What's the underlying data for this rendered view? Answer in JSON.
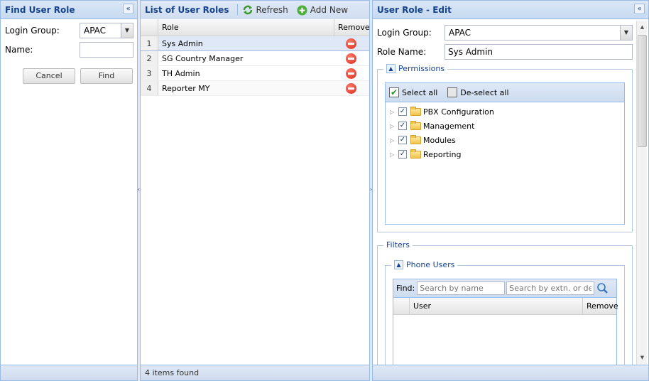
{
  "find_panel": {
    "title": "Find User Role",
    "login_group_label": "Login Group:",
    "login_group_value": "APAC",
    "name_label": "Name:",
    "name_value": "",
    "cancel_label": "Cancel",
    "find_label": "Find"
  },
  "list_panel": {
    "title": "List of User Roles",
    "refresh_label": "Refresh",
    "add_new_label": "Add New",
    "columns": {
      "role": "Role",
      "remove": "Remove"
    },
    "rows": [
      {
        "num": "1",
        "role": "Sys Admin"
      },
      {
        "num": "2",
        "role": "SG Country Manager"
      },
      {
        "num": "3",
        "role": "TH Admin"
      },
      {
        "num": "4",
        "role": "Reporter MY"
      }
    ],
    "status": "4 items found"
  },
  "edit_panel": {
    "title": "User Role - Edit",
    "login_group_label": "Login Group:",
    "login_group_value": "APAC",
    "role_name_label": "Role Name:",
    "role_name_value": "Sys Admin",
    "permissions": {
      "legend": "Permissions",
      "select_all": "Select all",
      "deselect_all": "De-select all",
      "items": [
        {
          "label": "PBX Configuration",
          "checked": true
        },
        {
          "label": "Management",
          "checked": true
        },
        {
          "label": "Modules",
          "checked": true
        },
        {
          "label": "Reporting",
          "checked": true
        }
      ]
    },
    "filters": {
      "legend": "Filters",
      "phone_users": {
        "legend": "Phone Users",
        "find_label": "Find:",
        "search_name_placeholder": "Search by name",
        "search_ext_placeholder": "Search by extn. or de",
        "columns": {
          "user": "User",
          "remove": "Remove"
        }
      }
    }
  },
  "colors": {
    "header_text": "#15428b",
    "panel_border": "#99bbe8",
    "selection": "#dfe8f6"
  }
}
